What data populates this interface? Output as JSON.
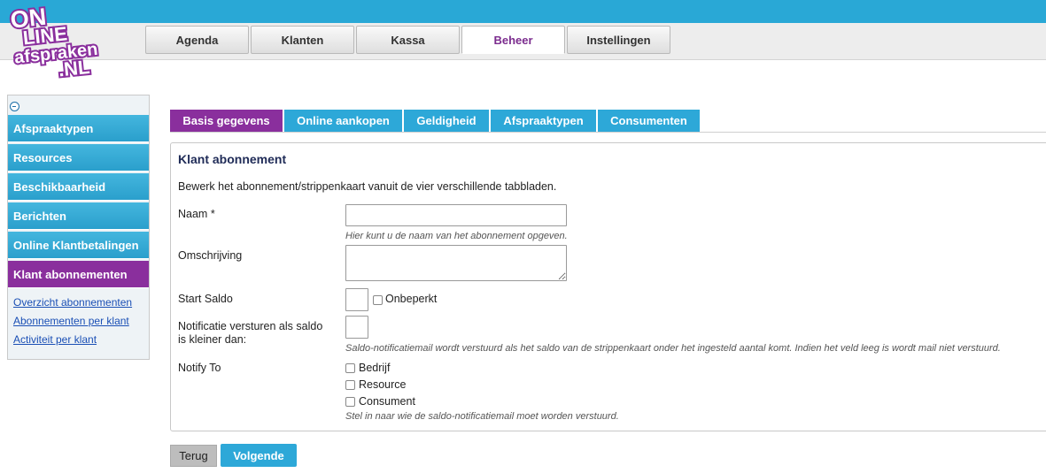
{
  "logo": {
    "line1": "ON",
    "line2": "LINE",
    "line3": "afspraken",
    "line4": ".NL"
  },
  "nav": [
    {
      "label": "Agenda"
    },
    {
      "label": "Klanten"
    },
    {
      "label": "Kassa"
    },
    {
      "label": "Beheer",
      "active": true
    },
    {
      "label": "Instellingen"
    }
  ],
  "sidebar": {
    "items": [
      {
        "label": "Afspraaktypen"
      },
      {
        "label": "Resources"
      },
      {
        "label": "Beschikbaarheid"
      },
      {
        "label": "Berichten"
      },
      {
        "label": "Online Klantbetalingen"
      },
      {
        "label": "Klant abonnementen",
        "active": true
      }
    ],
    "links": [
      {
        "label": "Overzicht abonnementen"
      },
      {
        "label": "Abonnementen per klant"
      },
      {
        "label": "Activiteit per klant"
      }
    ]
  },
  "tabs": [
    {
      "label": "Basis gegevens",
      "active": true
    },
    {
      "label": "Online aankopen"
    },
    {
      "label": "Geldigheid"
    },
    {
      "label": "Afspraaktypen"
    },
    {
      "label": "Consumenten"
    }
  ],
  "form": {
    "title": "Klant abonnement",
    "description": "Bewerk het abonnement/strippenkaart vanuit de vier verschillende tabbladen.",
    "naam": {
      "label": "Naam",
      "required": "*",
      "value": "",
      "hint": "Hier kunt u de naam van het abonnement opgeven."
    },
    "omschrijving": {
      "label": "Omschrijving",
      "value": ""
    },
    "start_saldo": {
      "label": "Start Saldo",
      "value": "",
      "unlimited_label": "Onbeperkt",
      "unlimited_checked": false
    },
    "notificatie": {
      "label_line1": "Notificatie versturen als saldo",
      "label_line2": "is kleiner dan:",
      "value": "",
      "hint": "Saldo-notificatiemail wordt verstuurd als het saldo van de strippenkaart onder het ingesteld aantal komt. Indien het veld leeg is wordt mail niet verstuurd."
    },
    "notify_to": {
      "label": "Notify To",
      "options": [
        {
          "label": "Bedrijf",
          "checked": false
        },
        {
          "label": "Resource",
          "checked": false
        },
        {
          "label": "Consument",
          "checked": false
        }
      ],
      "hint": "Stel in naar wie de saldo-notificatiemail moet worden verstuurd."
    }
  },
  "buttons": {
    "back": "Terug",
    "next": "Volgende"
  },
  "colors": {
    "header_blue": "#29a8d6",
    "purple": "#8a2f9d",
    "tab_blue": "#2da8d8",
    "title_navy": "#1f2b57"
  }
}
